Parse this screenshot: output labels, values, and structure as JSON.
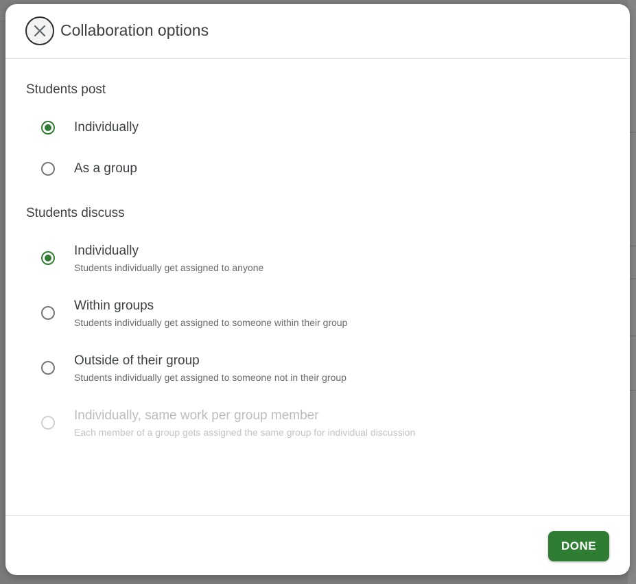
{
  "dialog": {
    "title": "Collaboration options",
    "close_icon": "close-icon"
  },
  "students_post": {
    "label": "Students post",
    "options": [
      {
        "label": "Individually",
        "selected": true,
        "disabled": false
      },
      {
        "label": "As a group",
        "selected": false,
        "disabled": false
      }
    ]
  },
  "students_discuss": {
    "label": "Students discuss",
    "options": [
      {
        "label": "Individually",
        "description": "Students individually get assigned to anyone",
        "selected": true,
        "disabled": false
      },
      {
        "label": "Within groups",
        "description": "Students individually get assigned to someone within their group",
        "selected": false,
        "disabled": false
      },
      {
        "label": "Outside of their group",
        "description": "Students individually get assigned to someone not in their group",
        "selected": false,
        "disabled": false
      },
      {
        "label": "Individually, same work per group member",
        "description": "Each member of a group gets assigned the same group for individual discussion",
        "selected": false,
        "disabled": true
      }
    ]
  },
  "footer": {
    "done_label": "DONE"
  },
  "colors": {
    "accent": "#2e7d32",
    "text": "#3c4043",
    "muted": "#6b6b6b",
    "disabled": "#bdbdbd"
  }
}
